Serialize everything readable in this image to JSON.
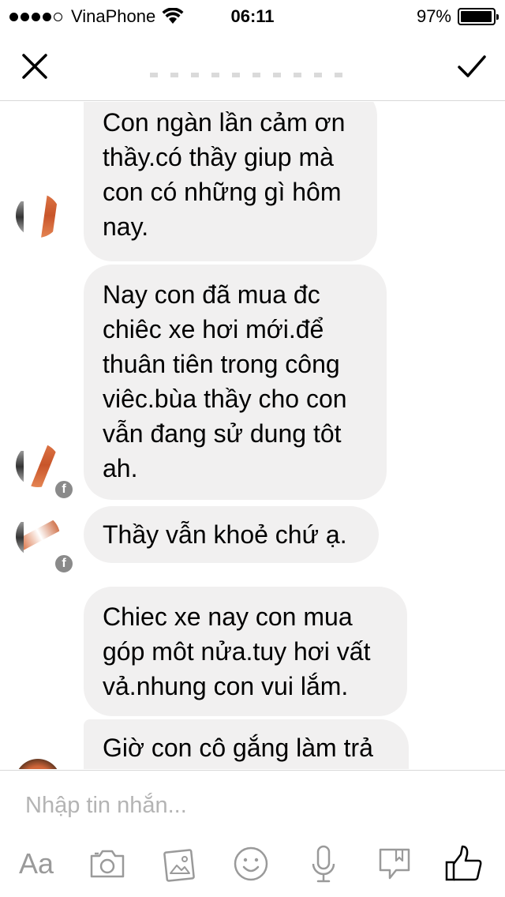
{
  "status_bar": {
    "carrier": "VinaPhone",
    "time": "06:11",
    "battery_percent": "97%",
    "battery_level": 0.97,
    "signal_dots": 5,
    "signal_filled": 4
  },
  "nav": {
    "title": "",
    "close_icon": "close-icon",
    "confirm_icon": "checkmark-icon"
  },
  "messages": [
    {
      "text": "Con ngàn lần cảm ơn thầy.có thầy giup mà con có những gì hôm nay."
    },
    {
      "text": "Nay con đã mua đc chiêc xe hơi mới.để thuân tiên trong công viêc.bùa thầy cho con vẫn đang sử dung tôt ah."
    },
    {
      "text": "Thầy vẫn khoẻ chứ ạ."
    },
    {
      "text": "Chiec xe nay con mua góp môt nửa.tuy hơi vất vả.nhung con vui lắm."
    },
    {
      "text": "Giờ con cô gắng làm trả"
    }
  ],
  "composer": {
    "placeholder": "Nhập tin nhắn...",
    "aa_label": "Aa"
  },
  "colors": {
    "bubble_bg": "#f1f0f0",
    "icon_gray": "#9a9a9a",
    "divider": "#d8d8d8"
  }
}
